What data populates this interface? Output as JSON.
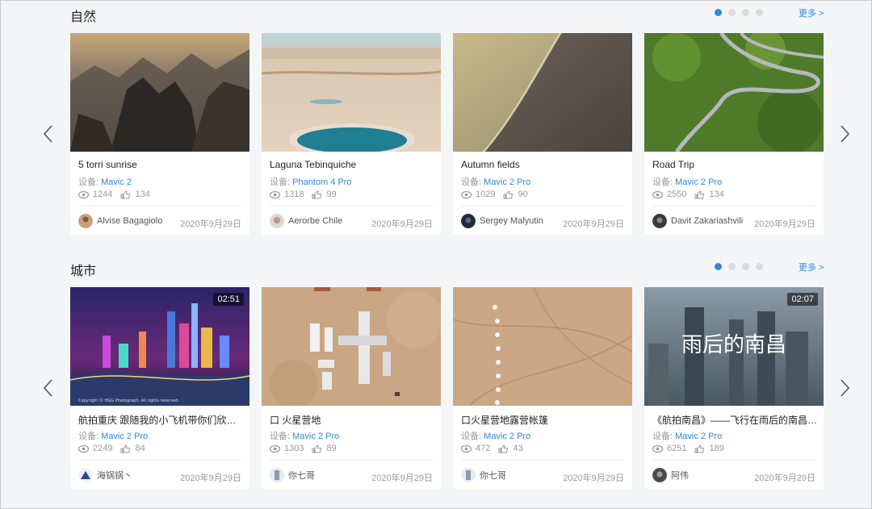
{
  "sections": [
    {
      "heading": "自然",
      "more_label": "更多 >",
      "cards": [
        {
          "title": "5 torri sunrise",
          "device_label": "设备: ",
          "model": "Mavic 2",
          "views": "1244",
          "likes": "134",
          "author": "Alvise Bagagiolo",
          "date": "2020年9月29日",
          "duration": ""
        },
        {
          "title": "Laguna Tebinquiche",
          "device_label": "设备: ",
          "model": "Phantom 4 Pro",
          "views": "1318",
          "likes": "99",
          "author": "Aerorbe Chile",
          "date": "2020年9月29日",
          "duration": ""
        },
        {
          "title": "Autumn fields",
          "device_label": "设备: ",
          "model": "Mavic 2 Pro",
          "views": "1029",
          "likes": "90",
          "author": "Sergey Malyutin",
          "date": "2020年9月29日",
          "duration": ""
        },
        {
          "title": "Road Trip",
          "device_label": "设备: ",
          "model": "Mavic 2 Pro",
          "views": "2550",
          "likes": "134",
          "author": "Davit Zakariashvili",
          "date": "2020年9月29日",
          "duration": ""
        }
      ]
    },
    {
      "heading": "城市",
      "more_label": "更多 >",
      "cards": [
        {
          "title": "航拍重庆 跟随我的小飞机带你们欣赏山城夜景",
          "device_label": "设备: ",
          "model": "Mavic 2 Pro",
          "views": "2249",
          "likes": "84",
          "author": "海锅锅丶",
          "date": "2020年9月29日",
          "duration": "02:51"
        },
        {
          "title": "口 火星营地",
          "device_label": "设备: ",
          "model": "Mavic 2 Pro",
          "views": "1303",
          "likes": "89",
          "author": "你七哥",
          "date": "2020年9月29日",
          "duration": ""
        },
        {
          "title": "口火星营地露营帐篷",
          "device_label": "设备: ",
          "model": "Mavic 2 Pro",
          "views": "472",
          "likes": "43",
          "author": "你七哥",
          "date": "2020年9月29日",
          "duration": ""
        },
        {
          "title": "《航拍南昌》——飞行在雨后的南昌上空",
          "device_label": "设备: ",
          "model": "Mavic 2 Pro",
          "views": "6251",
          "likes": "189",
          "author": "阿伟",
          "date": "2020年9月29日",
          "duration": "02:07"
        }
      ]
    }
  ],
  "thumbnail_overlay_text": "雨后的南昌",
  "thumbnail_watermark": "Copyright © HGG Photograph. All rights reserved.",
  "icons": {
    "views": "eye-icon",
    "likes": "thumbs-up-icon",
    "prev": "chevron-left-icon",
    "next": "chevron-right-icon"
  },
  "colors": {
    "accent": "#2f88e0",
    "background": "#f4f5f7",
    "card": "#ffffff",
    "muted": "#999999"
  }
}
